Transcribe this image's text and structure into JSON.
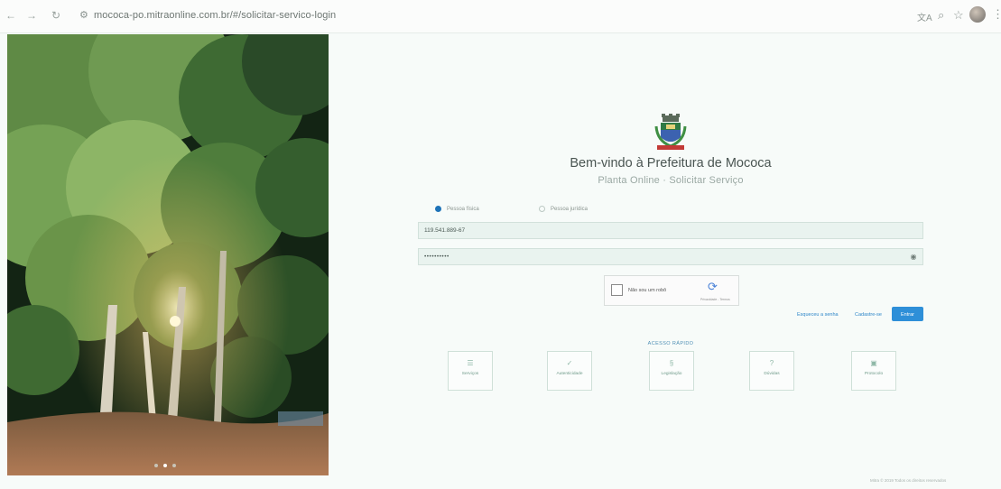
{
  "browser": {
    "url": "mococa-po.mitraonline.com.br/#/solicitar-servico-login"
  },
  "page": {
    "title": "Bem-vindo à Prefeitura de Mococa",
    "subtitle": "Planta Online · Solicitar Serviço"
  },
  "form": {
    "radio_fisica": "Pessoa física",
    "radio_juridica": "Pessoa jurídica",
    "cpf_value": "119.541.889-67",
    "password_value": "••••••••••",
    "captcha_label": "Não sou um robô",
    "captcha_privacy": "Privacidade - Termos",
    "forgot_password": "Esqueceu a senha",
    "register": "Cadastre-se",
    "submit": "Entrar"
  },
  "quick_access": {
    "title": "ACESSO RÁPIDO",
    "items": [
      {
        "label": "Serviços"
      },
      {
        "label": "Autenticidade"
      },
      {
        "label": "Legislação"
      },
      {
        "label": "Dúvidas"
      },
      {
        "label": "Protocolo"
      }
    ]
  },
  "footer": {
    "text": "Mitra © 2019 Todos os direitos reservados"
  },
  "icons": {
    "back": "arrow-left",
    "forward": "arrow-right",
    "reload": "reload",
    "site_info": "tune",
    "translate": "translate",
    "zoom": "magnifier",
    "bookmark": "star",
    "eye": "eye"
  },
  "colors": {
    "accent": "#2e8fd8",
    "background": "#f7fbf9",
    "field_bg": "#e9f3ef"
  },
  "carousel": {
    "slides": 3,
    "active": 1
  }
}
